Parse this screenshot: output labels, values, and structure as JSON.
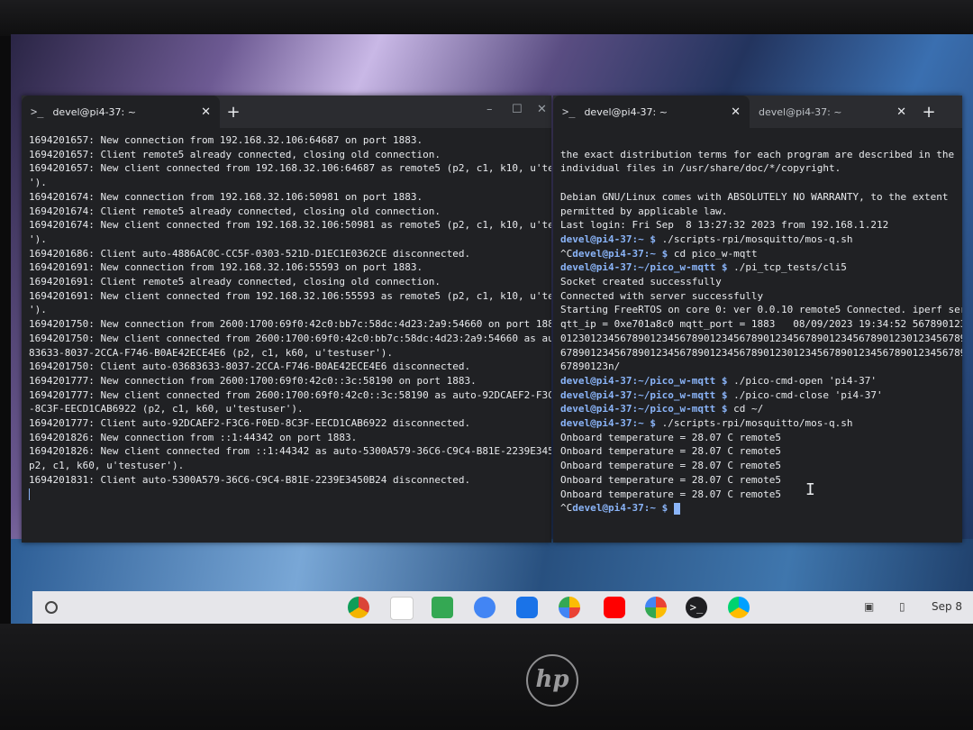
{
  "left_terminal": {
    "tab_title": "devel@pi4-37: ~",
    "lines": [
      "1694201657: New connection from 192.168.32.106:64687 on port 1883.",
      "1694201657: Client remote5 already connected, closing old connection.",
      "1694201657: New client connected from 192.168.32.106:64687 as remote5 (p2, c1, k10, u'testuser",
      "').",
      "1694201674: New connection from 192.168.32.106:50981 on port 1883.",
      "1694201674: Client remote5 already connected, closing old connection.",
      "1694201674: New client connected from 192.168.32.106:50981 as remote5 (p2, c1, k10, u'testuser",
      "').",
      "1694201686: Client auto-4886AC0C-CC5F-0303-521D-D1EC1E0362CE disconnected.",
      "1694201691: New connection from 192.168.32.106:55593 on port 1883.",
      "1694201691: Client remote5 already connected, closing old connection.",
      "1694201691: New client connected from 192.168.32.106:55593 as remote5 (p2, c1, k10, u'testuser",
      "').",
      "1694201750: New connection from 2600:1700:69f0:42c0:bb7c:58dc:4d23:2a9:54660 on port 1883.",
      "1694201750: New client connected from 2600:1700:69f0:42c0:bb7c:58dc:4d23:2a9:54660 as auto-036",
      "83633-8037-2CCA-F746-B0AE42ECE4E6 (p2, c1, k60, u'testuser').",
      "1694201750: Client auto-03683633-8037-2CCA-F746-B0AE42ECE4E6 disconnected.",
      "1694201777: New connection from 2600:1700:69f0:42c0::3c:58190 on port 1883.",
      "1694201777: New client connected from 2600:1700:69f0:42c0::3c:58190 as auto-92DCAEF2-F3C6-F0ED",
      "-8C3F-EECD1CAB6922 (p2, c1, k60, u'testuser').",
      "1694201777: Client auto-92DCAEF2-F3C6-F0ED-8C3F-EECD1CAB6922 disconnected.",
      "1694201826: New connection from ::1:44342 on port 1883.",
      "1694201826: New client connected from ::1:44342 as auto-5300A579-36C6-C9C4-B81E-2239E3450B24 (",
      "p2, c1, k60, u'testuser').",
      "1694201831: Client auto-5300A579-36C6-C9C4-B81E-2239E3450B24 disconnected."
    ]
  },
  "right_terminal": {
    "tab1_title": "devel@pi4-37: ~",
    "tab2_title": "devel@pi4-37: ~",
    "pre_lines": [
      "the exact distribution terms for each program are described in the",
      "individual files in /usr/share/doc/*/copyright.",
      "",
      "Debian GNU/Linux comes with ABSOLUTELY NO WARRANTY, to the extent",
      "permitted by applicable law.",
      "Last login: Fri Sep  8 13:27:32 2023 from 192.168.1.212"
    ],
    "cmd1_prefix": "",
    "cmd1_user": "devel@pi4-37",
    "cmd1_path": ":~ $",
    "cmd1": " ./scripts-rpi/mosquitto/mos-q.sh",
    "cmd2_prefix": "^C",
    "cmd2_user": "devel@pi4-37",
    "cmd2_path": ":~ $",
    "cmd2": " cd pico_w-mqtt",
    "cmd3_user": "devel@pi4-37",
    "cmd3_path": ":~/pico_w-mqtt $",
    "cmd3": " ./pi_tcp_tests/cli5",
    "mid_lines": [
      "Socket created successfully",
      "Connected with server successfully",
      "Starting FreeRTOS on core 0: ver 0.0.10 remote5 Connected. iperf server 192.1",
      "qtt_ip = 0xe701a8c0 mqtt_port = 1883   08/09/2023 19:34:52 567890123456789012",
      "01230123456789012345678901234567890123456789012345678901230123456789012345678",
      "67890123456789012345678901234567890123012345678901234567890123456789012345678",
      "67890123n/"
    ],
    "cmd4_user": "devel@pi4-37",
    "cmd4_path": ":~/pico_w-mqtt $",
    "cmd4": " ./pico-cmd-open 'pi4-37'",
    "cmd5_user": "devel@pi4-37",
    "cmd5_path": ":~/pico_w-mqtt $",
    "cmd5": " ./pico-cmd-close 'pi4-37'",
    "cmd6_user": "devel@pi4-37",
    "cmd6_path": ":~/pico_w-mqtt $",
    "cmd6": " cd ~/",
    "cmd7_user": "devel@pi4-37",
    "cmd7_path": ":~ $",
    "cmd7": " ./scripts-rpi/mosquitto/mos-q.sh",
    "temp_lines": [
      "Onboard temperature = 28.07 C remote5",
      "Onboard temperature = 28.07 C remote5",
      "Onboard temperature = 28.07 C remote5",
      "Onboard temperature = 28.07 C remote5",
      "Onboard temperature = 28.07 C remote5"
    ],
    "final_prefix": "^C",
    "final_user": "devel@pi4-37",
    "final_path": ":~ $"
  },
  "shelf": {
    "date": "Sep 8"
  }
}
